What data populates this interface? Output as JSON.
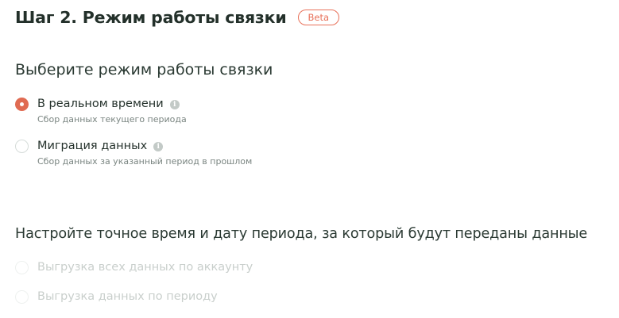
{
  "header": {
    "title": "Шаг 2. Режим работы связки",
    "badge": "Beta"
  },
  "mode_section": {
    "title": "Выберите режим работы связки",
    "options": [
      {
        "label": "В реальном времени",
        "description": "Сбор данных текущего периода",
        "selected": true,
        "info_icon": "info-icon"
      },
      {
        "label": "Миграция данных",
        "description": "Сбор данных за указанный период в прошлом",
        "selected": false,
        "info_icon": "info-icon"
      }
    ]
  },
  "period_section": {
    "title": "Настройте точное время и дату периода, за который будут переданы данные",
    "options": [
      {
        "label": "Выгрузка всех данных по аккаунту",
        "disabled": true
      },
      {
        "label": "Выгрузка данных по периоду",
        "disabled": true
      }
    ]
  },
  "colors": {
    "accent": "#e06b52",
    "badge": "#e8715a",
    "text": "#23302a",
    "muted": "#7a8581",
    "disabled": "#c9cfcc"
  }
}
